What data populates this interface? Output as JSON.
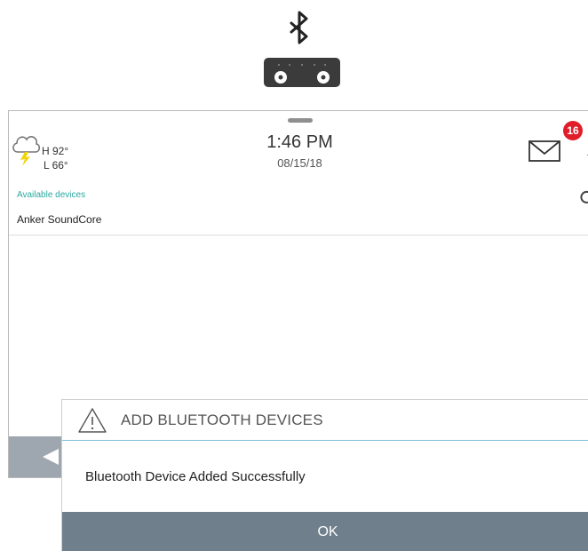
{
  "hero": {
    "icon": "bluetooth-speaker-icon"
  },
  "status_bar": {
    "weather": {
      "icon": "cloud-lightning-icon",
      "high": "H 92°",
      "low": "L 66°"
    },
    "time": "1:46 PM",
    "date": "08/15/18",
    "messages": {
      "icon": "envelope-icon",
      "badge_count": "16",
      "badge_color": "#e21d2a"
    }
  },
  "devices": {
    "heading": "Available devices",
    "heading_color": "#2aa8a0",
    "items": [
      {
        "name": "Anker SoundCore"
      }
    ]
  },
  "dialog": {
    "icon": "warning-icon",
    "title": "ADD BLUETOOTH DEVICES",
    "message": "Bluetooth Device Added Successfully",
    "ok_label": "OK",
    "ok_color": "#6f7f8c"
  }
}
